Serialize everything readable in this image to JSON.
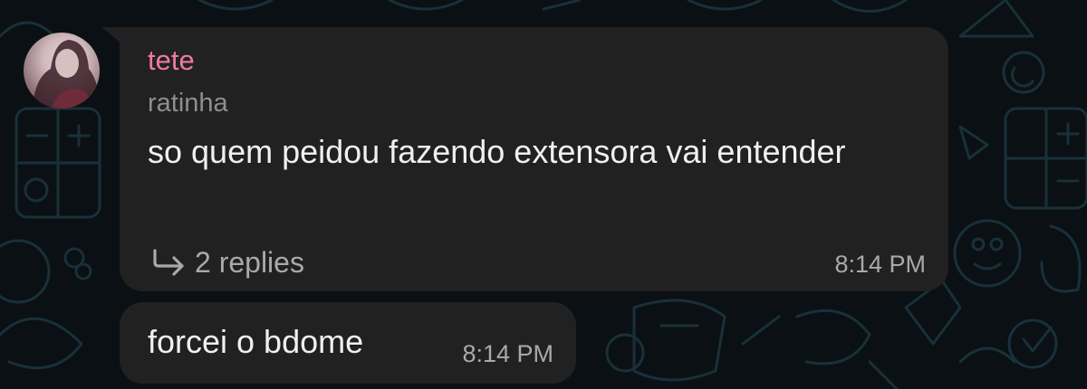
{
  "chat": {
    "messages": [
      {
        "sender": "tete",
        "reply_to": "ratinha",
        "text": "so quem peidou fazendo extensora vai entender",
        "replies_label": "2 replies",
        "time": "8:14 PM"
      },
      {
        "text": "forcei o bdome",
        "time": "8:14 PM"
      }
    ]
  },
  "colors": {
    "background": "#0b1014",
    "bubble": "#212121",
    "sender": "#ee7aa0",
    "text": "#f0f0f0",
    "meta": "#a9a9a9",
    "wallpaper_lines": "#18303a"
  },
  "icons": {
    "replies": "reply-arrow-icon",
    "avatar": "profile-photo"
  }
}
